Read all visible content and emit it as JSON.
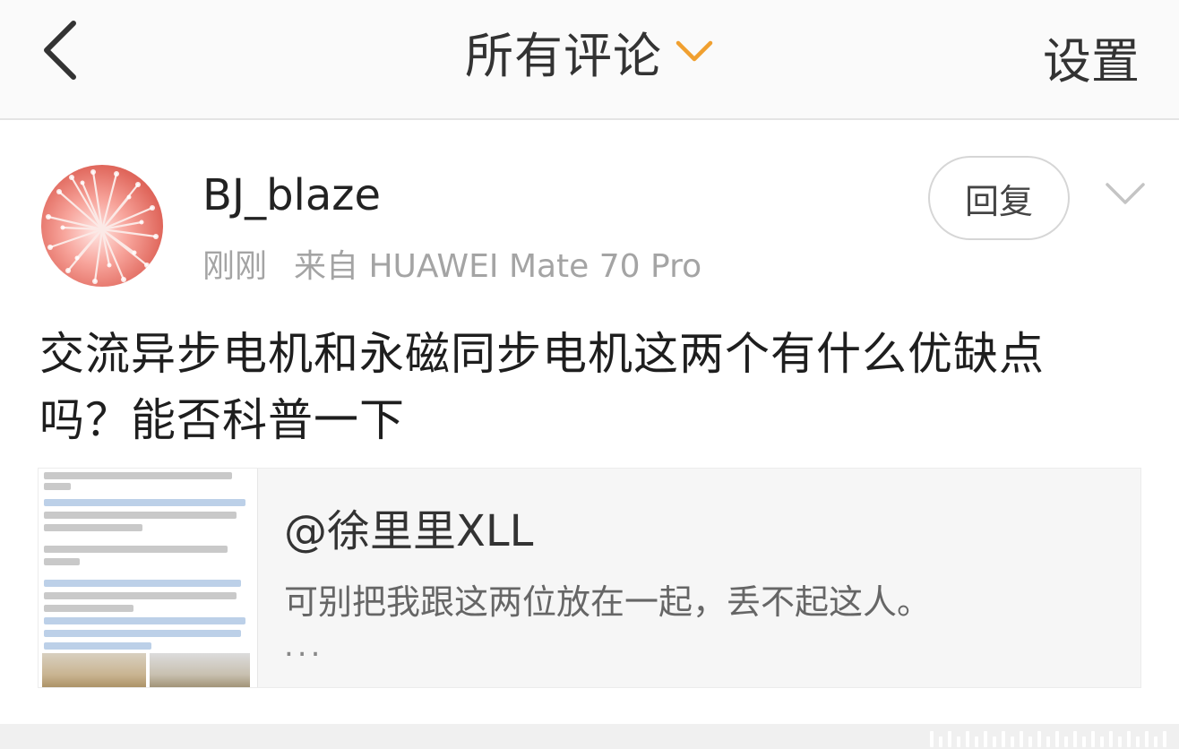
{
  "header": {
    "back_icon": "chevron-left-icon",
    "title": "所有评论",
    "title_chevron_icon": "chevron-down-icon",
    "settings_label": "设置",
    "accent_color": "#f0a030"
  },
  "comment": {
    "username": "BJ_blaze",
    "time": "刚刚",
    "source": "来自 HUAWEI Mate 70 Pro",
    "reply_label": "回复",
    "more_icon": "chevron-down-icon",
    "text": "交流异步电机和永磁同步电机这两个有什么优缺点吗？能否科普一下",
    "quote": {
      "author": "@徐里里XLL",
      "text": "可别把我跟这两位放在一起，丢不起这人。",
      "ellipsis": "..."
    }
  }
}
